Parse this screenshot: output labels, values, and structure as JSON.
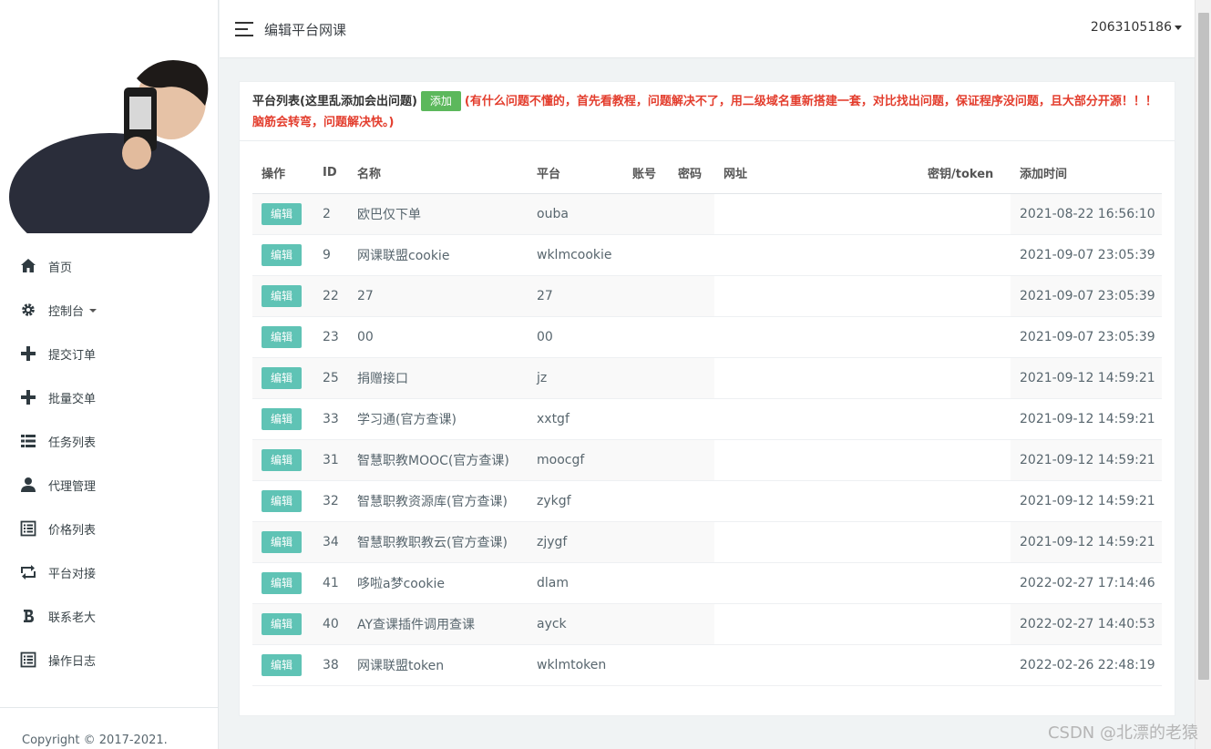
{
  "header": {
    "title": "编辑平台网课",
    "user": "2063105186"
  },
  "sidebar": {
    "items": [
      {
        "label": "首页",
        "icon": "home-icon"
      },
      {
        "label": "控制台",
        "icon": "gear-icon",
        "has_caret": true
      },
      {
        "label": "提交订单",
        "icon": "plus-icon"
      },
      {
        "label": "批量交单",
        "icon": "plus-icon"
      },
      {
        "label": "任务列表",
        "icon": "list-icon"
      },
      {
        "label": "代理管理",
        "icon": "user-icon"
      },
      {
        "label": "价格列表",
        "icon": "list-alt-icon"
      },
      {
        "label": "平台对接",
        "icon": "retweet-icon"
      },
      {
        "label": "联系老大",
        "icon": "bitcoin-icon"
      },
      {
        "label": "操作日志",
        "icon": "list-alt-icon"
      }
    ],
    "copyright": "Copyright © 2017-2021."
  },
  "panel": {
    "title": "平台列表(这里乱添加会出问题)",
    "add_label": "添加",
    "warning": "(有什么问题不懂的，首先看教程，问题解决不了，用二级域名重新搭建一套，对比找出问题，保证程序没问题，且大部分开源！！！脑筋会转弯，问题解决快。)"
  },
  "table": {
    "columns": [
      "操作",
      "ID",
      "名称",
      "平台",
      "账号",
      "密码",
      "网址",
      "密钥/token",
      "添加时间"
    ],
    "edit_label": "编辑",
    "rows": [
      {
        "id": "2",
        "name": "欧巴仅下单",
        "platform": "ouba",
        "account": "",
        "password": "",
        "url": "",
        "token": "",
        "time": "2021-08-22 16:56:10"
      },
      {
        "id": "9",
        "name": "网课联盟cookie",
        "platform": "wklmcookie",
        "account": "",
        "password": "",
        "url": "",
        "token": "",
        "time": "2021-09-07 23:05:39"
      },
      {
        "id": "22",
        "name": "27",
        "platform": "27",
        "account": "",
        "password": "",
        "url": "",
        "token": "",
        "time": "2021-09-07 23:05:39"
      },
      {
        "id": "23",
        "name": "00",
        "platform": "00",
        "account": "",
        "password": "",
        "url": "",
        "token": "",
        "time": "2021-09-07 23:05:39"
      },
      {
        "id": "25",
        "name": "捐赠接口",
        "platform": "jz",
        "account": "",
        "password": "",
        "url": "",
        "token": "",
        "time": "2021-09-12 14:59:21"
      },
      {
        "id": "33",
        "name": "学习通(官方查课)",
        "platform": "xxtgf",
        "account": "",
        "password": "",
        "url": "",
        "token": "",
        "time": "2021-09-12 14:59:21"
      },
      {
        "id": "31",
        "name": "智慧职教MOOC(官方查课)",
        "platform": "moocgf",
        "account": "",
        "password": "",
        "url": "",
        "token": "",
        "time": "2021-09-12 14:59:21"
      },
      {
        "id": "32",
        "name": "智慧职教资源库(官方查课)",
        "platform": "zykgf",
        "account": "",
        "password": "",
        "url": "",
        "token": "",
        "time": "2021-09-12 14:59:21"
      },
      {
        "id": "34",
        "name": "智慧职教职教云(官方查课)",
        "platform": "zjygf",
        "account": "",
        "password": "",
        "url": "",
        "token": "",
        "time": "2021-09-12 14:59:21"
      },
      {
        "id": "41",
        "name": "哆啦a梦cookie",
        "platform": "dlam",
        "account": "",
        "password": "",
        "url": "",
        "token": "",
        "time": "2022-02-27 17:14:46"
      },
      {
        "id": "40",
        "name": "AY查课插件调用查课",
        "platform": "ayck",
        "account": "",
        "password": "",
        "url": "",
        "token": "",
        "time": "2022-02-27 14:40:53"
      },
      {
        "id": "38",
        "name": "网课联盟token",
        "platform": "wklmtoken",
        "account": "",
        "password": "",
        "url": "",
        "token": "",
        "time": "2022-02-26 22:48:19"
      }
    ]
  },
  "watermark": "CSDN @北漂的老猿",
  "colors": {
    "add_button": "#5cb85c",
    "edit_button": "#5fc3b5",
    "warning_text": "#e33d2d"
  }
}
